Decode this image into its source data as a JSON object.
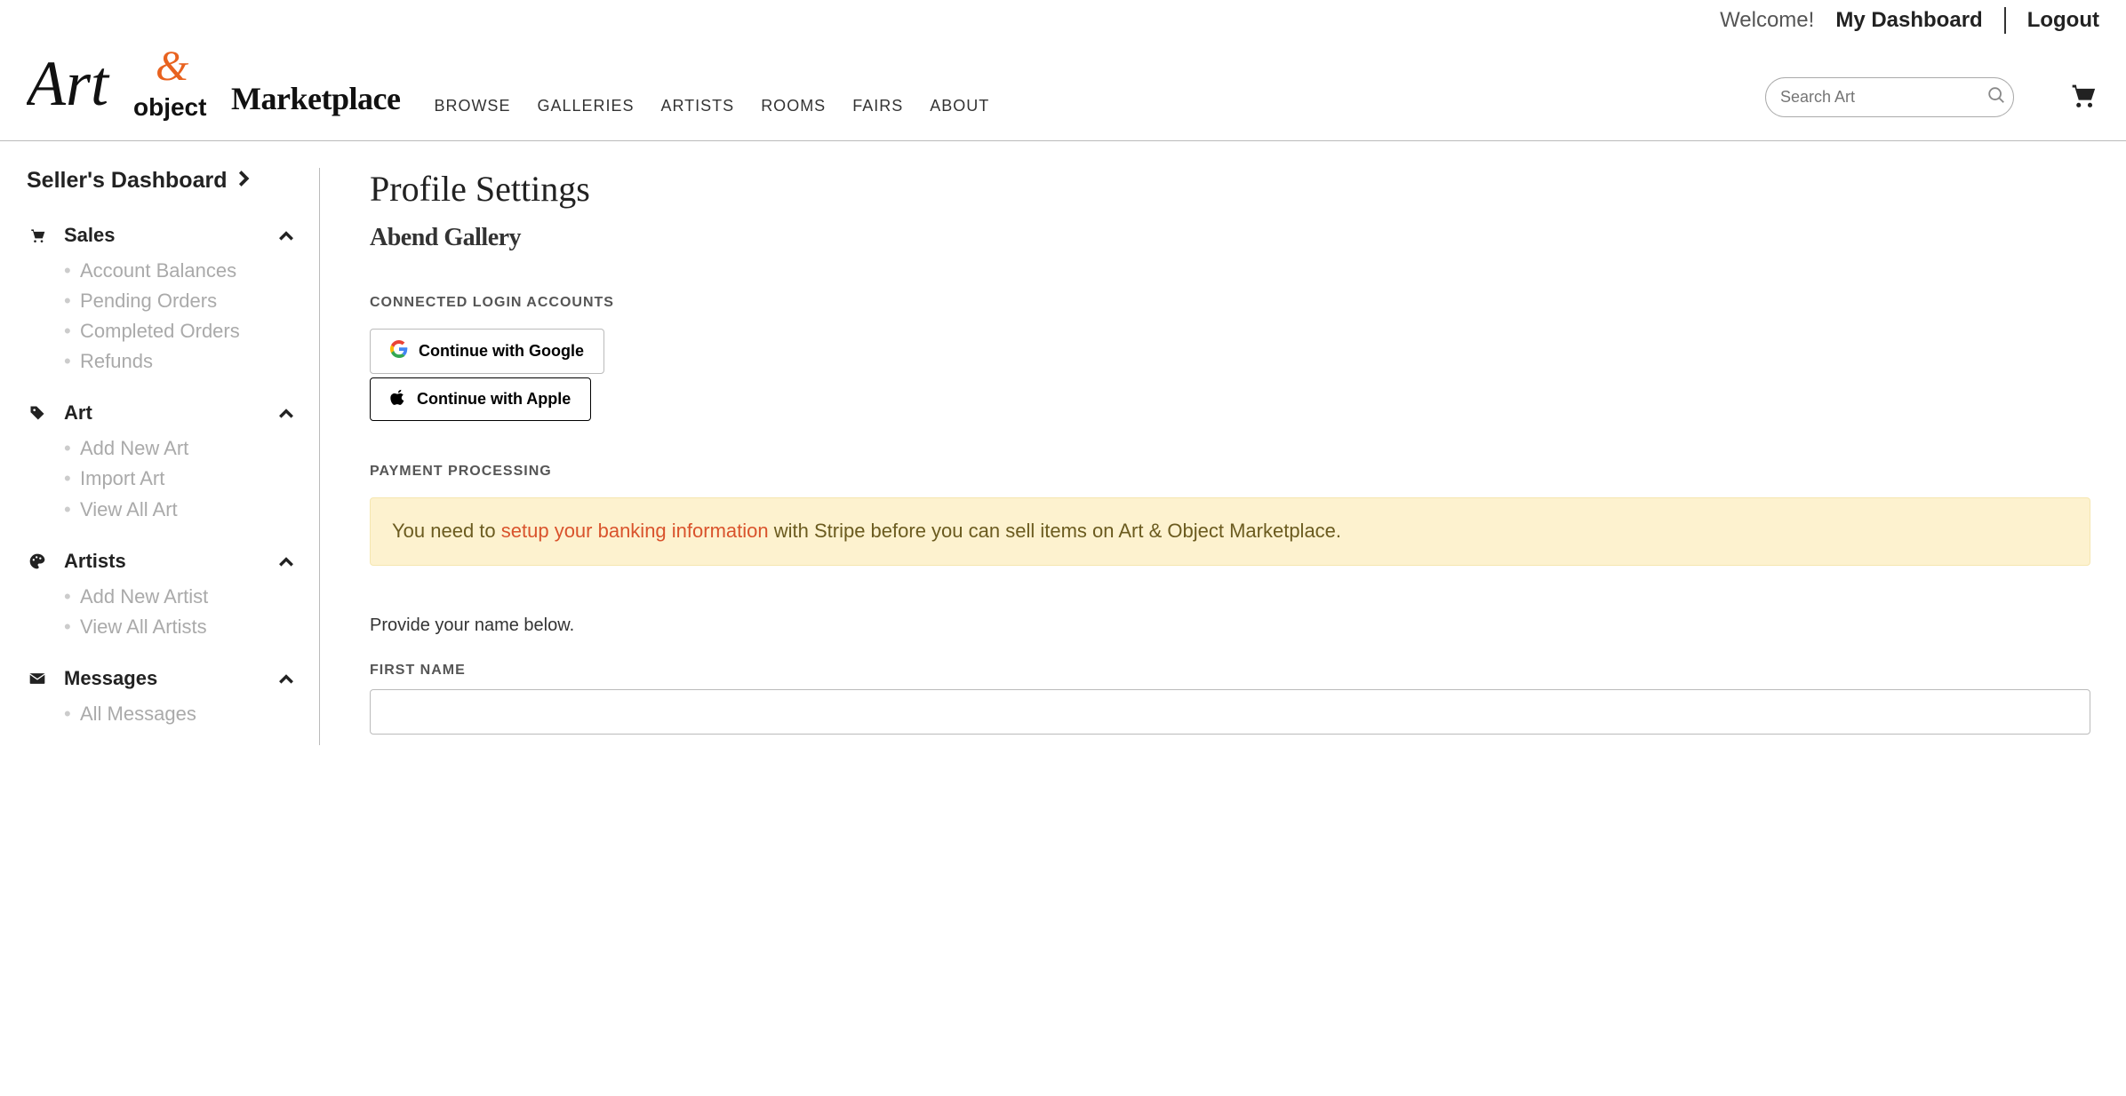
{
  "topbar": {
    "welcome": "Welcome!",
    "dashboard": "My Dashboard",
    "logout": "Logout"
  },
  "header": {
    "marketplace": "Marketplace",
    "nav": {
      "browse": "BROWSE",
      "galleries": "GALLERIES",
      "artists": "ARTISTS",
      "rooms": "ROOMS",
      "fairs": "FAIRS",
      "about": "ABOUT"
    },
    "search_placeholder": "Search Art"
  },
  "sidebar": {
    "title": "Seller's Dashboard",
    "groups": {
      "sales": {
        "label": "Sales",
        "items": [
          "Account Balances",
          "Pending Orders",
          "Completed Orders",
          "Refunds"
        ]
      },
      "art": {
        "label": "Art",
        "items": [
          "Add New Art",
          "Import Art",
          "View All Art"
        ]
      },
      "artists": {
        "label": "Artists",
        "items": [
          "Add New Artist",
          "View All Artists"
        ]
      },
      "messages": {
        "label": "Messages",
        "items": [
          "All Messages"
        ]
      }
    }
  },
  "content": {
    "title": "Profile Settings",
    "gallery_name": "Abend Gallery",
    "connected_label": "CONNECTED LOGIN ACCOUNTS",
    "google_btn": "Continue with Google",
    "apple_btn": "Continue with Apple",
    "payment_label": "PAYMENT PROCESSING",
    "alert_pre": "You need to ",
    "alert_link": "setup your banking information",
    "alert_post": " with Stripe before you can sell items on Art & Object Marketplace.",
    "helper": "Provide your name below.",
    "first_name_label": "FIRST NAME",
    "first_name_value": ""
  }
}
